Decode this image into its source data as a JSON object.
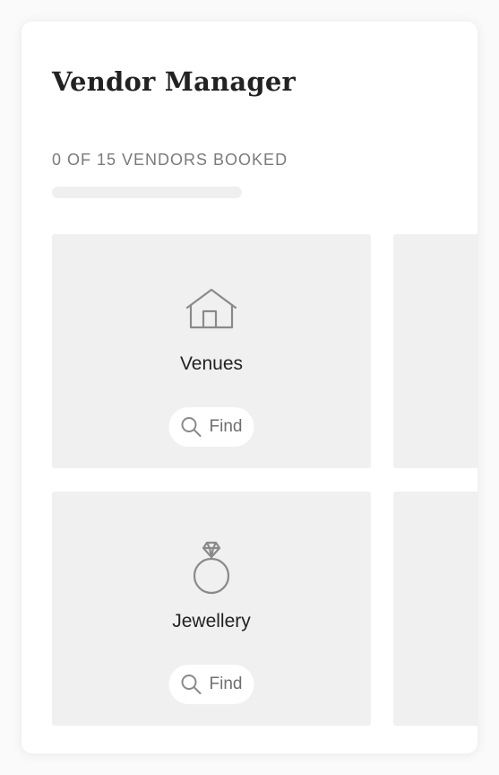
{
  "header": {
    "title": "Vendor Manager"
  },
  "progress": {
    "label": "0 OF 15 VENDORS BOOKED",
    "booked": 0,
    "total": 15
  },
  "vendors": [
    {
      "label": "Venues",
      "icon": "house-icon",
      "button_label": "Find"
    },
    {
      "label": "",
      "icon": "",
      "button_label": ""
    },
    {
      "label": "Jewellery",
      "icon": "ring-icon",
      "button_label": "Find"
    },
    {
      "label": "",
      "icon": "",
      "button_label": ""
    }
  ],
  "colors": {
    "tile_background": "#f0f0f0",
    "icon": "#8a8a8a",
    "text": "#222222",
    "muted_text": "#7a7a7a"
  }
}
